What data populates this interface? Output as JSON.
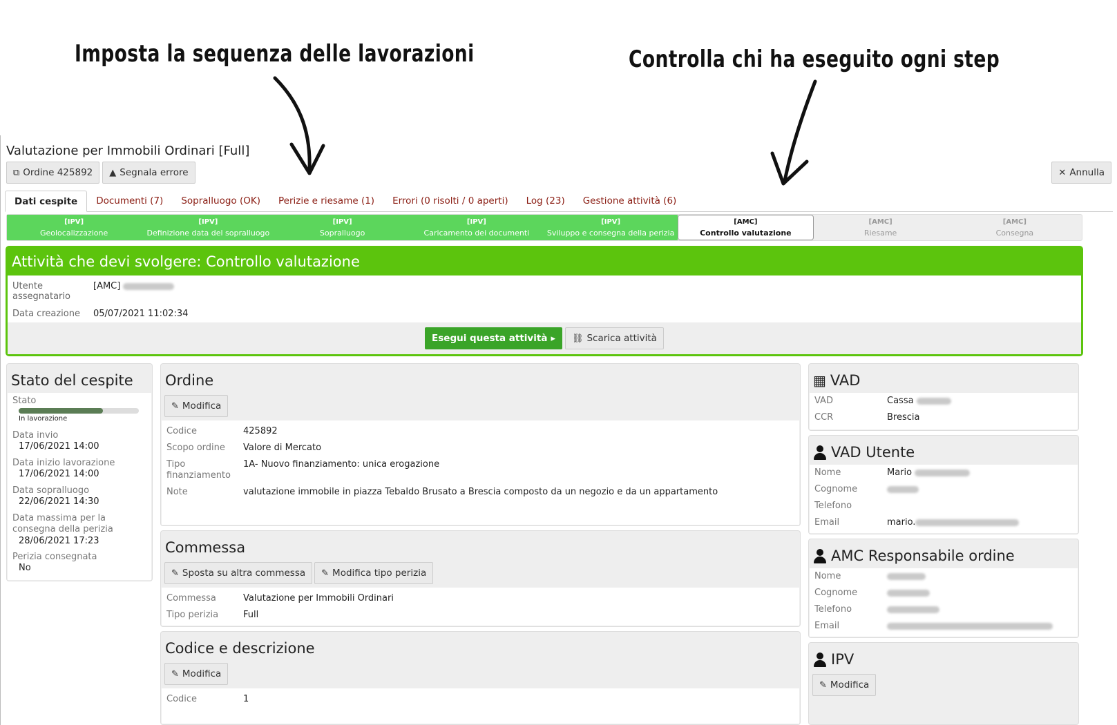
{
  "annotations": {
    "left": "Imposta la sequenza delle lavorazioni",
    "right": "Controlla chi ha eseguito ogni step"
  },
  "page": {
    "title": "Valutazione per Immobili Ordinari [Full]",
    "order_button": "Ordine 425892",
    "report_button": "Segnala errore",
    "cancel_button": "Annulla"
  },
  "tabs": [
    "Dati cespite",
    "Documenti (7)",
    "Sopralluogo (OK)",
    "Perizie e riesame (1)",
    "Errori (0 risolti / 0 aperti)",
    "Log (23)",
    "Gestione attività (6)"
  ],
  "steps": [
    {
      "code": "[IPV]",
      "label": "Geolocalizzazione",
      "state": "done"
    },
    {
      "code": "[IPV]",
      "label": "Definizione data del sopralluogo",
      "state": "done"
    },
    {
      "code": "[IPV]",
      "label": "Sopralluogo",
      "state": "done"
    },
    {
      "code": "[IPV]",
      "label": "Caricamento dei documenti",
      "state": "done"
    },
    {
      "code": "[IPV]",
      "label": "Sviluppo e consegna della perizia",
      "state": "done"
    },
    {
      "code": "[AMC]",
      "label": "Controllo valutazione",
      "state": "current"
    },
    {
      "code": "[AMC]",
      "label": "Riesame",
      "state": "todo"
    },
    {
      "code": "[AMC]",
      "label": "Consegna",
      "state": "todo"
    }
  ],
  "activity": {
    "title": "Attività che devi svolgere: Controllo valutazione",
    "user_label": "Utente assegnatario",
    "user_value": "[AMC]",
    "created_label": "Data creazione",
    "created_value": "05/07/2021 11:02:34",
    "execute_button": "Esegui questa attività",
    "discard_button": "Scarica attività"
  },
  "stato": {
    "title": "Stato del cespite",
    "state_label": "Stato",
    "progress": 0.7,
    "state_value": "In lavorazione",
    "fields": [
      {
        "label": "Data invio",
        "value": "17/06/2021 14:00"
      },
      {
        "label": "Data inizio lavorazione",
        "value": "17/06/2021 14:00"
      },
      {
        "label": "Data sopralluogo",
        "value": "22/06/2021 14:30"
      },
      {
        "label": "Data massima per la consegna della perizia",
        "value": "28/06/2021 17:23"
      },
      {
        "label": "Perizia consegnata",
        "value": "No"
      }
    ]
  },
  "ordine": {
    "title": "Ordine",
    "edit_button": "Modifica",
    "fields": [
      {
        "label": "Codice",
        "value": "425892"
      },
      {
        "label": "Scopo ordine",
        "value": "Valore di Mercato"
      },
      {
        "label": "Tipo finanziamento",
        "value": "1A- Nuovo finanziamento: unica erogazione"
      },
      {
        "label": "Note",
        "value": "valutazione immobile in piazza Tebaldo Brusato a Brescia composto da un negozio e da un appartamento"
      }
    ]
  },
  "commessa": {
    "title": "Commessa",
    "move_button": "Sposta su altra commessa",
    "edit_type_button": "Modifica tipo perizia",
    "fields": [
      {
        "label": "Commessa",
        "value": "Valutazione per Immobili Ordinari"
      },
      {
        "label": "Tipo perizia",
        "value": "Full"
      }
    ]
  },
  "codice": {
    "title": "Codice e descrizione",
    "edit_button": "Modifica",
    "fields": [
      {
        "label": "Codice",
        "value": "1"
      }
    ]
  },
  "vad": {
    "title": "VAD",
    "fields": [
      {
        "label": "VAD",
        "value": "Cassa"
      },
      {
        "label": "CCR",
        "value": "Brescia"
      }
    ]
  },
  "vad_utente": {
    "title": "VAD Utente",
    "fields": [
      {
        "label": "Nome",
        "value": "Mario"
      },
      {
        "label": "Cognome",
        "value": ""
      },
      {
        "label": "Telefono",
        "value": ""
      },
      {
        "label": "Email",
        "value": "mario."
      }
    ]
  },
  "amc": {
    "title": "AMC Responsabile ordine",
    "fields": [
      {
        "label": "Nome",
        "value": ""
      },
      {
        "label": "Cognome",
        "value": ""
      },
      {
        "label": "Telefono",
        "value": ""
      },
      {
        "label": "Email",
        "value": ""
      }
    ]
  },
  "ipv": {
    "title": "IPV",
    "edit_button": "Modifica"
  }
}
